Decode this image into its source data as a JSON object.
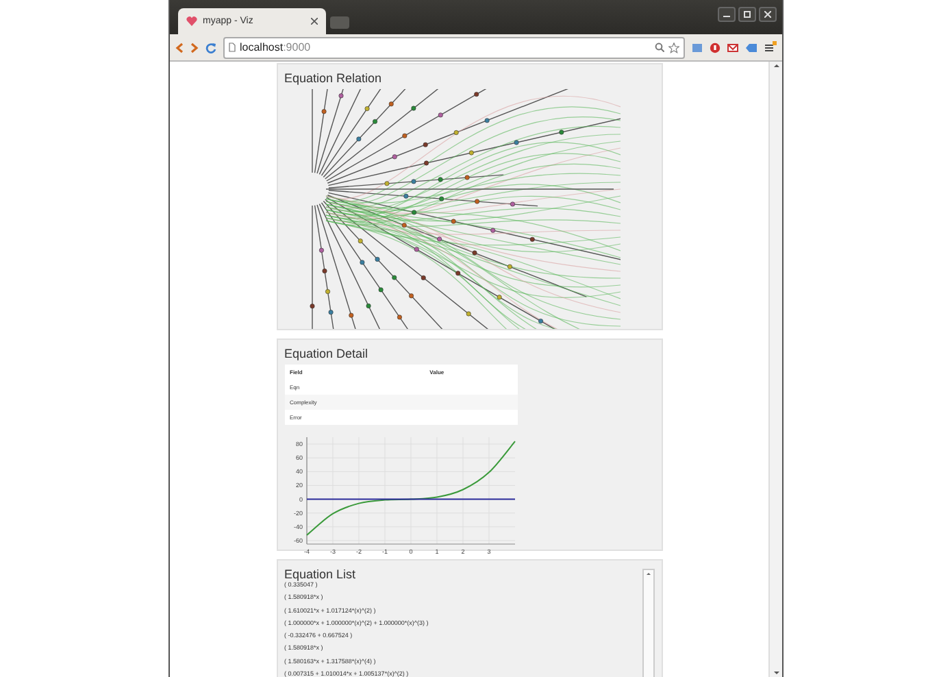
{
  "browser": {
    "tab_title": "myapp - Viz",
    "url_host": "localhost",
    "url_port": ":9000"
  },
  "relation": {
    "title": "Equation Relation"
  },
  "detail": {
    "title": "Equation Detail",
    "table": {
      "columns": [
        "Field",
        "Value"
      ],
      "rows": [
        {
          "field": "Eqn"
        },
        {
          "field": "Complexity"
        },
        {
          "field": "Error"
        }
      ]
    },
    "chart_data": {
      "type": "line",
      "x": [
        -4,
        -3,
        -2,
        -1,
        0,
        1,
        2,
        3,
        4
      ],
      "series": [
        {
          "color": "#3a9a3a",
          "values": [
            -52,
            -21,
            -6,
            -1,
            0,
            3,
            14,
            39,
            84
          ]
        },
        {
          "color": "#2b2b9a",
          "values": [
            0,
            0,
            0,
            0,
            0,
            0,
            0,
            0,
            0
          ]
        }
      ],
      "grid": true,
      "xlim": [
        -4,
        4
      ],
      "ylim": [
        -65,
        90
      ],
      "xticks": [
        -4,
        -3,
        -2,
        -1,
        0,
        1,
        2,
        3
      ],
      "yticks": [
        -60,
        -40,
        -20,
        0,
        20,
        40,
        60,
        80
      ]
    }
  },
  "list": {
    "title": "Equation List",
    "items": [
      "( 0.335047 )",
      "( 1.580918*x )",
      "( 1.610021*x + 1.017124*(x)^(2) )",
      "( 1.000000*x + 1.000000*(x)^(2) + 1.000000*(x)^(3) )",
      "( -0.332476 + 0.667524 )",
      "( 1.580918*x )",
      "( 1.580163*x + 1.317588*(x)^(4) )",
      "( 0.007315 + 1.010014*x + 1.005137*(x)^(2) )"
    ]
  }
}
